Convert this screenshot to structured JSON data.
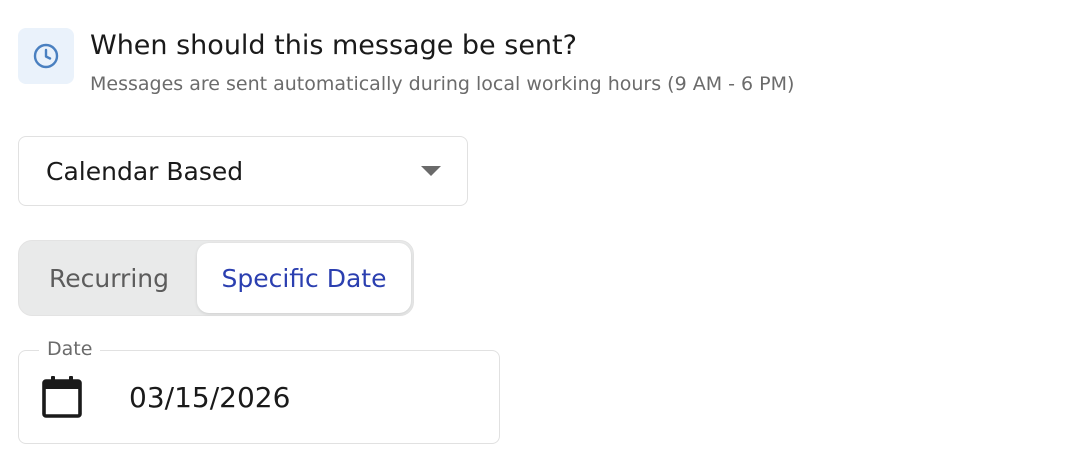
{
  "header": {
    "title": "When should this message be sent?",
    "subtitle": "Messages are sent automatically during local working hours (9 AM - 6 PM)",
    "icon": "clock-icon"
  },
  "schedule_type": {
    "selected": "Calendar Based",
    "icon": "chevron-down-icon"
  },
  "mode_toggle": {
    "options": [
      {
        "label": "Recurring",
        "selected": false
      },
      {
        "label": "Specific Date",
        "selected": true
      }
    ]
  },
  "date_field": {
    "label": "Date",
    "value": "03/15/2026",
    "icon": "calendar-icon"
  },
  "colors": {
    "accent": "#2b3fb0",
    "icon_blue": "#4a80c0",
    "icon_tile": "#eaf2fb",
    "muted_text": "#6b6b6b",
    "border": "#e1e1e1",
    "toggle_bg": "#e9eaea"
  }
}
